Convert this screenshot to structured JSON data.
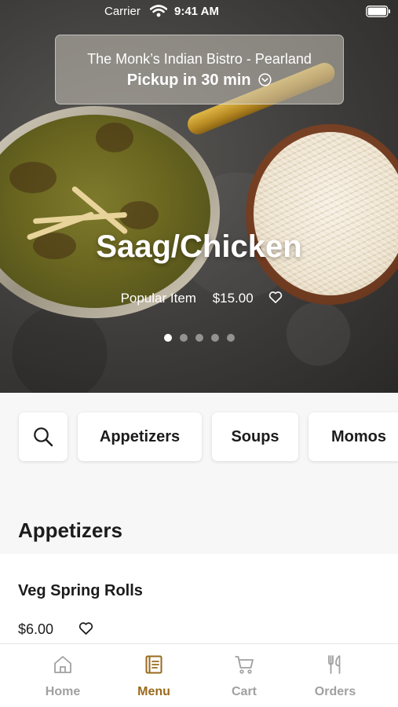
{
  "status_bar": {
    "carrier": "Carrier",
    "time": "9:41 AM"
  },
  "location": {
    "name": "The Monk’s Indian Bistro - Pearland",
    "pickup": "Pickup in 30 min",
    "icon": "chevron-down-circle-icon"
  },
  "hero": {
    "title": "Saag/Chicken",
    "tag": "Popular Item",
    "price": "$15.00",
    "dot_count": 5,
    "active_dot": 0
  },
  "categories": [
    "Appetizers",
    "Soups",
    "Momos"
  ],
  "section": {
    "title": "Appetizers",
    "items": [
      {
        "name": "Veg Spring Rolls",
        "price": "$6.00"
      }
    ]
  },
  "tabs": [
    {
      "label": "Home",
      "icon": "home-icon",
      "active": false
    },
    {
      "label": "Menu",
      "icon": "menu-book-icon",
      "active": true
    },
    {
      "label": "Cart",
      "icon": "cart-icon",
      "active": false
    },
    {
      "label": "Orders",
      "icon": "fork-knife-icon",
      "active": false
    }
  ],
  "colors": {
    "accent": "#9a6a1c",
    "inactive_tab": "#a0a0a0"
  }
}
